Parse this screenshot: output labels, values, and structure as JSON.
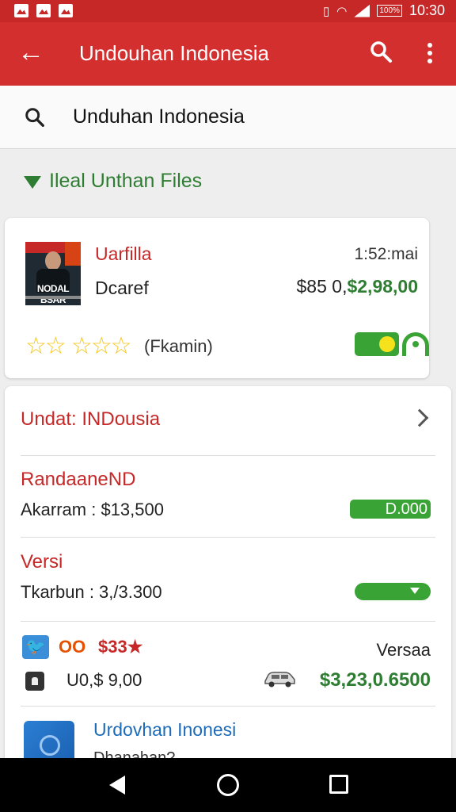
{
  "status_bar": {
    "time": "10:30",
    "battery": "100%"
  },
  "app_bar": {
    "title": "Undouhan Indonesia"
  },
  "search": {
    "value": "Unduhan Indonesia"
  },
  "section": {
    "title": "Ileal Unthan Files"
  },
  "featured": {
    "name": "Uarfilla",
    "time": "1:52:mai",
    "subtitle": "Dcaref",
    "price_old": "$85 0,",
    "price_new": "$2,98,00",
    "reviews": "(Fkamin)",
    "thumb_caption": "NODAL BSAR",
    "rating": 5
  },
  "list": {
    "header": "Undat: INDousia",
    "items": [
      {
        "title": "RandaaneND",
        "detail": "Akarram : $13,500",
        "badge": "D.000"
      },
      {
        "title": "Versi",
        "detail": "Tkarbun : 3,/3.300"
      }
    ],
    "promo": {
      "tw_glyph": "🐦",
      "oo_label": "OO",
      "price": "$33★",
      "right_label": "Versaa",
      "lower_price": "U0,$ 9,00",
      "green_price": "$3,23,0.6500"
    },
    "last": {
      "title": "Urdovhan Inonesi",
      "detail": "Dhanahan?"
    }
  },
  "colors": {
    "brand_red": "#d32f2f",
    "accent_green": "#2e7d32",
    "star_yellow": "#f5c518"
  }
}
